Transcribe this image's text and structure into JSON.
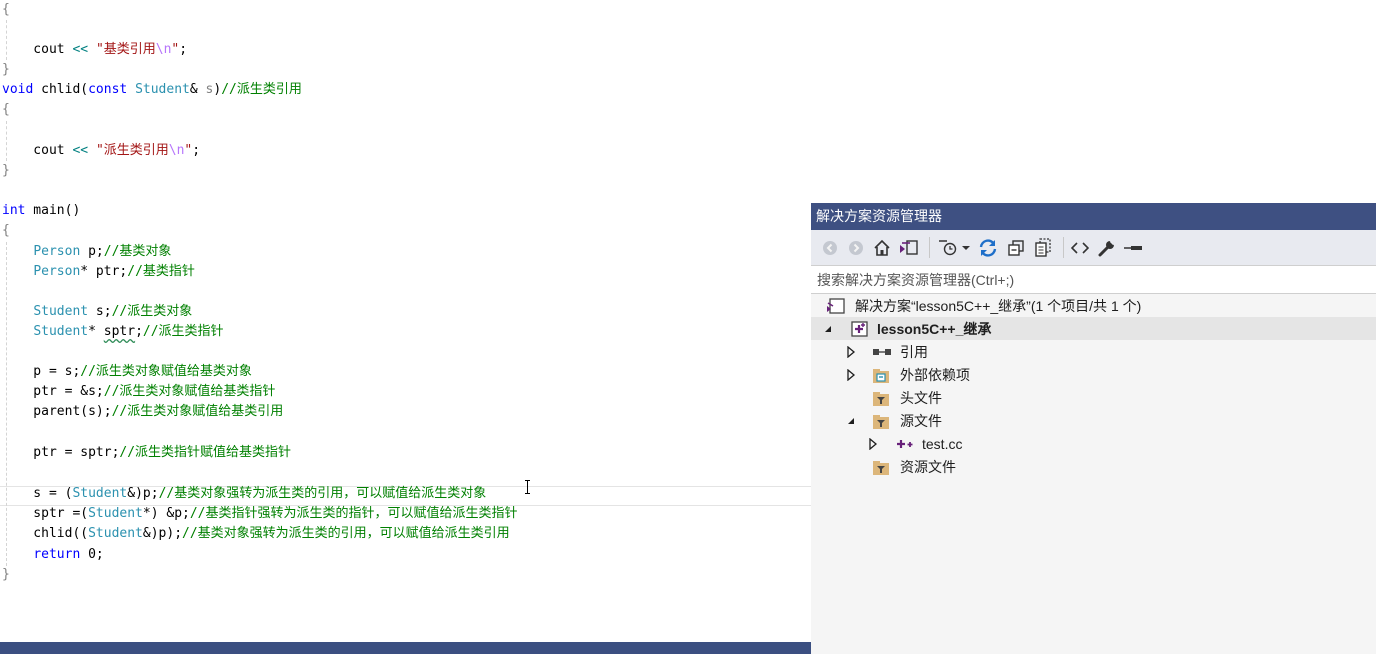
{
  "editor": {
    "lines": [
      [
        {
          "c": "pr",
          "t": "{"
        }
      ],
      [],
      [
        {
          "t": "    cout "
        },
        {
          "c": "op",
          "t": "<<"
        },
        {
          "t": " "
        },
        {
          "c": "str",
          "t": "\"基类引用"
        },
        {
          "c": "esc",
          "t": "\\n"
        },
        {
          "c": "str",
          "t": "\""
        },
        {
          "t": ";"
        }
      ],
      [
        {
          "c": "pr",
          "t": "}"
        }
      ],
      [
        {
          "c": "kw",
          "t": "void"
        },
        {
          "t": " chlid("
        },
        {
          "c": "kw",
          "t": "const"
        },
        {
          "t": " "
        },
        {
          "c": "ty",
          "t": "Student"
        },
        {
          "t": "& "
        },
        {
          "c": "pr",
          "t": "s"
        },
        {
          "t": ")"
        },
        {
          "c": "cm",
          "t": "//派生类引用"
        }
      ],
      [
        {
          "c": "pr",
          "t": "{"
        }
      ],
      [],
      [
        {
          "t": "    cout "
        },
        {
          "c": "op",
          "t": "<<"
        },
        {
          "t": " "
        },
        {
          "c": "str",
          "t": "\"派生类引用"
        },
        {
          "c": "esc",
          "t": "\\n"
        },
        {
          "c": "str",
          "t": "\""
        },
        {
          "t": ";"
        }
      ],
      [
        {
          "c": "pr",
          "t": "}"
        }
      ],
      [],
      [
        {
          "c": "kw",
          "t": "int"
        },
        {
          "t": " main()"
        }
      ],
      [
        {
          "c": "pr",
          "t": "{"
        }
      ],
      [
        {
          "t": "    "
        },
        {
          "c": "ty",
          "t": "Person"
        },
        {
          "t": " p;"
        },
        {
          "c": "cm",
          "t": "//基类对象"
        }
      ],
      [
        {
          "t": "    "
        },
        {
          "c": "ty",
          "t": "Person"
        },
        {
          "t": "* ptr;"
        },
        {
          "c": "cm",
          "t": "//基类指针"
        }
      ],
      [],
      [
        {
          "t": "    "
        },
        {
          "c": "ty",
          "t": "Student"
        },
        {
          "t": " s;"
        },
        {
          "c": "cm",
          "t": "//派生类对象"
        }
      ],
      [
        {
          "t": "    "
        },
        {
          "c": "ty",
          "t": "Student"
        },
        {
          "t": "* "
        },
        {
          "c": "squiggle",
          "t": "sptr"
        },
        {
          "t": ";"
        },
        {
          "c": "cm",
          "t": "//派生类指针"
        }
      ],
      [],
      [
        {
          "t": "    p = s;"
        },
        {
          "c": "cm",
          "t": "//派生类对象赋值给基类对象"
        }
      ],
      [
        {
          "t": "    ptr = &s;"
        },
        {
          "c": "cm",
          "t": "//派生类对象赋值给基类指针"
        }
      ],
      [
        {
          "t": "    parent(s);"
        },
        {
          "c": "cm",
          "t": "//派生类对象赋值给基类引用"
        }
      ],
      [],
      [
        {
          "t": "    ptr = sptr;"
        },
        {
          "c": "cm",
          "t": "//派生类指针赋值给基类指针"
        }
      ],
      [],
      [
        {
          "t": "    s = ("
        },
        {
          "c": "ty",
          "t": "Student"
        },
        {
          "t": "&)p;"
        },
        {
          "c": "cm",
          "t": "//基类对象强转为派生类的引用，可以赋值给派生类对象"
        }
      ],
      [
        {
          "t": "    sptr =("
        },
        {
          "c": "ty",
          "t": "Student"
        },
        {
          "t": "*) &p;"
        },
        {
          "c": "cm",
          "t": "//基类指针强转为派生类的指针，可以赋值给派生类指针"
        }
      ],
      [
        {
          "t": "    chlid(("
        },
        {
          "c": "ty",
          "t": "Student"
        },
        {
          "t": "&)p);"
        },
        {
          "c": "cm",
          "t": "//基类对象强转为派生类的引用，可以赋值给派生类引用"
        }
      ],
      [
        {
          "t": "    "
        },
        {
          "c": "kw",
          "t": "return"
        },
        {
          "t": " 0;"
        }
      ],
      [
        {
          "c": "pr",
          "t": "}"
        }
      ]
    ]
  },
  "solution_explorer": {
    "title": "解决方案资源管理器",
    "search_placeholder": "搜索解决方案资源管理器(Ctrl+;)",
    "toolbar_icons": [
      "back-icon",
      "forward-icon",
      "home-icon",
      "switch-views-icon",
      "pending-changes-filter-icon",
      "dropdown-arrow-icon",
      "sync-icon",
      "collapse-all-icon",
      "show-all-files-icon",
      "view-code-icon",
      "properties-icon",
      "preview-icon"
    ],
    "tree": [
      {
        "label": "解决方案“lesson5C++_继承”(1 个项目/共 1 个)",
        "icon": "solution-icon",
        "arrow": "",
        "bold": false
      },
      {
        "label": "lesson5C++_继承",
        "icon": "cpp-project-icon",
        "arrow": "expanded",
        "bold": true
      },
      {
        "label": "引用",
        "icon": "references-icon",
        "arrow": "collapsed",
        "bold": false
      },
      {
        "label": "外部依赖项",
        "icon": "external-deps-icon",
        "arrow": "collapsed",
        "bold": false
      },
      {
        "label": "头文件",
        "icon": "filter-folder-icon",
        "arrow": "",
        "bold": false
      },
      {
        "label": "源文件",
        "icon": "filter-folder-icon",
        "arrow": "expanded",
        "bold": false
      },
      {
        "label": "test.cc",
        "icon": "cpp-file-icon",
        "arrow": "collapsed",
        "bold": false
      },
      {
        "label": "资源文件",
        "icon": "filter-folder-icon",
        "arrow": "",
        "bold": false
      }
    ]
  },
  "colors": {
    "title_bar": "#3e5082",
    "status_bar": "#3b4f81",
    "keyword": "#0000ff",
    "type": "#2b91af",
    "comment": "#008000",
    "string": "#a31515"
  }
}
